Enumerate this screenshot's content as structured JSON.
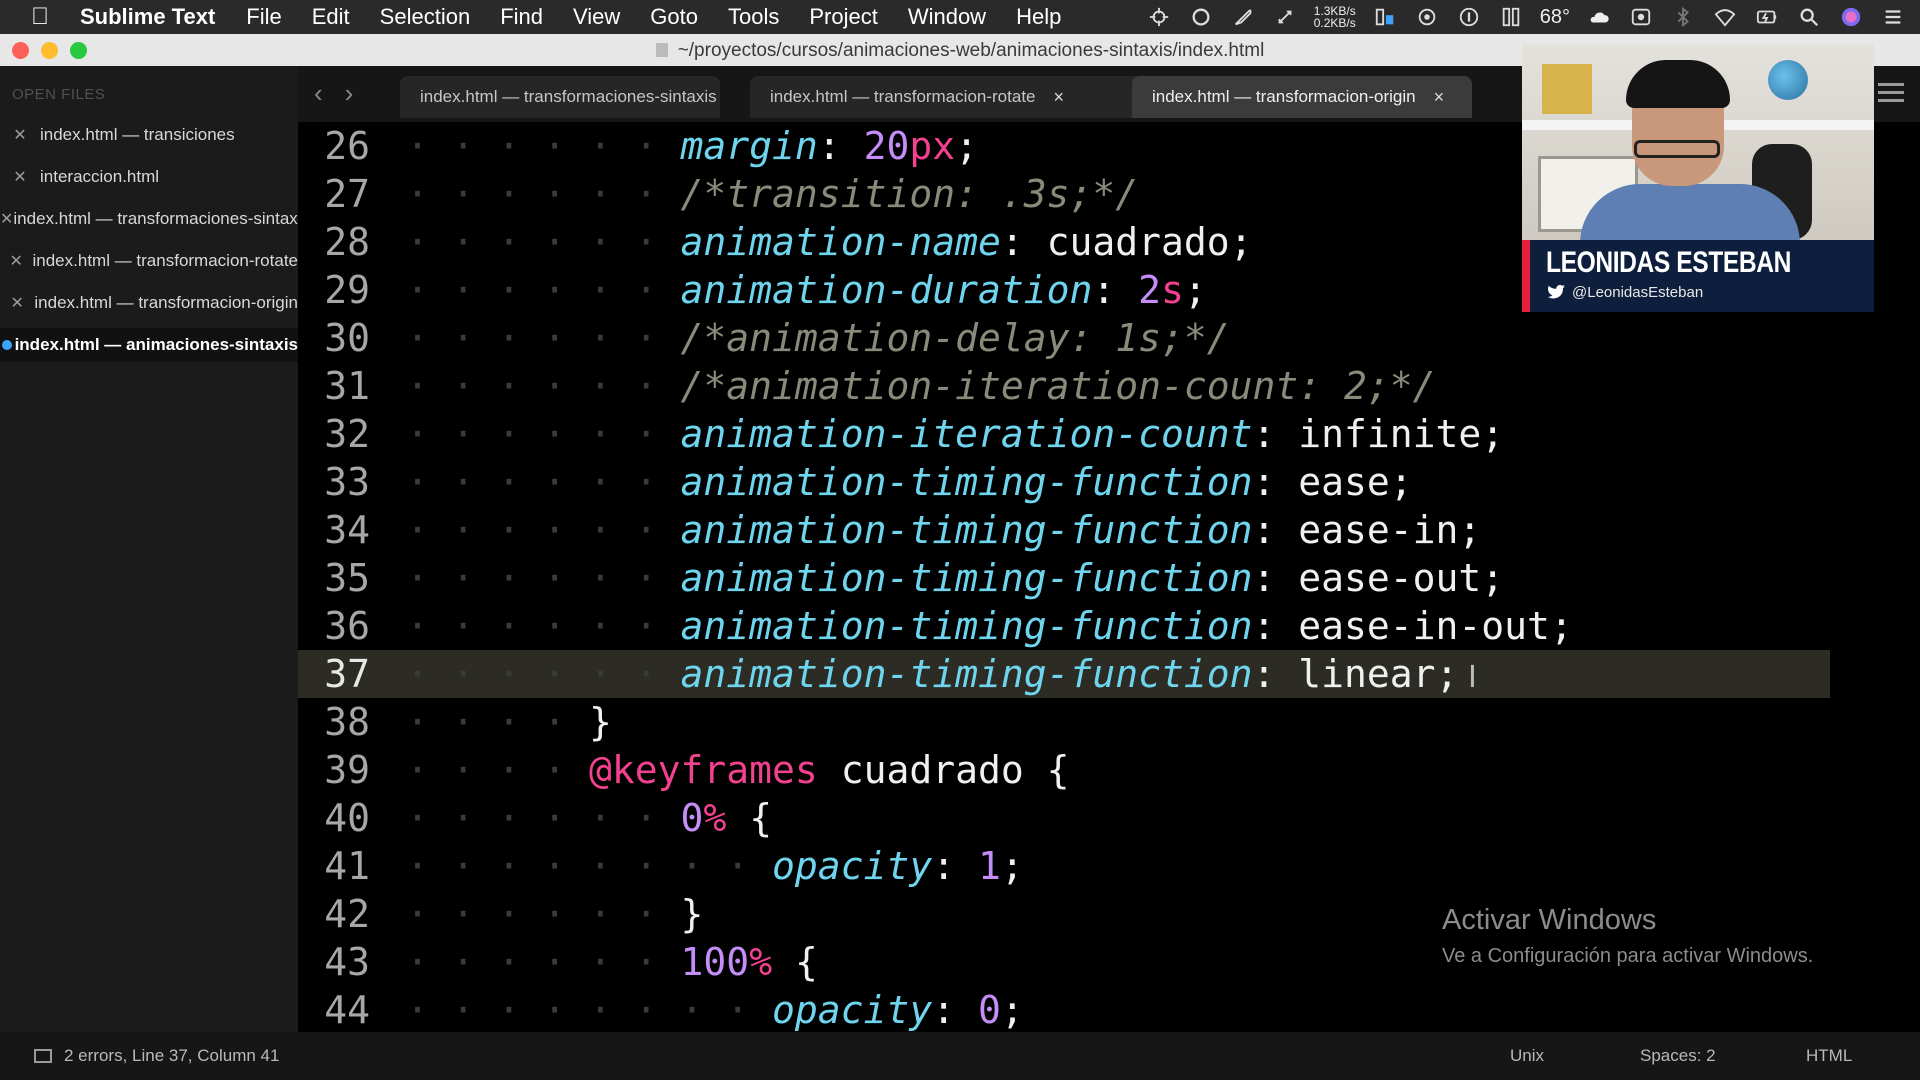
{
  "menubar": {
    "apple_icon": "apple-logo-icon",
    "app_name": "Sublime Text",
    "menus": [
      "File",
      "Edit",
      "Selection",
      "Find",
      "View",
      "Goto",
      "Tools",
      "Project",
      "Window",
      "Help"
    ],
    "net_up": "1.3KB/s",
    "net_down": "0.2KB/s",
    "temperature": "68°"
  },
  "window": {
    "title": "~/proyectos/cursos/animaciones-web/animaciones-sintaxis/index.html"
  },
  "sidebar": {
    "header": "OPEN FILES",
    "items": [
      {
        "label": "index.html — transiciones",
        "active": false
      },
      {
        "label": "interaccion.html",
        "active": false
      },
      {
        "label": "index.html — transformaciones-sintaxis",
        "active": false
      },
      {
        "label": "index.html — transformacion-rotate",
        "active": false
      },
      {
        "label": "index.html — transformacion-origin",
        "active": false
      },
      {
        "label": "index.html — animaciones-sintaxis",
        "active": true
      }
    ]
  },
  "tabs": [
    {
      "label": "index.html — transformaciones-sintaxis",
      "close": ""
    },
    {
      "label": "index.html — transformacion-rotate",
      "close": "×"
    },
    {
      "label": "index.html — transformacion-origin",
      "close": "×"
    }
  ],
  "editor": {
    "current_line": 37,
    "lines": [
      {
        "n": "26",
        "indent": 3
      },
      {
        "n": "27",
        "indent": 3
      },
      {
        "n": "28",
        "indent": 3
      },
      {
        "n": "29",
        "indent": 3
      },
      {
        "n": "30",
        "indent": 3
      },
      {
        "n": "31",
        "indent": 3
      },
      {
        "n": "32",
        "indent": 3
      },
      {
        "n": "33",
        "indent": 3
      },
      {
        "n": "34",
        "indent": 3
      },
      {
        "n": "35",
        "indent": 3
      },
      {
        "n": "36",
        "indent": 3
      },
      {
        "n": "37",
        "indent": 3
      },
      {
        "n": "38",
        "indent": 2
      },
      {
        "n": "39",
        "indent": 2
      },
      {
        "n": "40",
        "indent": 3
      },
      {
        "n": "41",
        "indent": 4
      },
      {
        "n": "42",
        "indent": 3
      },
      {
        "n": "43",
        "indent": 3
      },
      {
        "n": "44",
        "indent": 4
      }
    ],
    "tokens": {
      "l26": [
        [
          "prop",
          "margin"
        ],
        [
          "punc",
          ": "
        ],
        [
          "num",
          "20"
        ],
        [
          "unit",
          "px"
        ],
        [
          "punc",
          ";"
        ]
      ],
      "l27": [
        [
          "cm",
          "/*transition: .3s;*/"
        ]
      ],
      "l28": [
        [
          "prop",
          "animation-name"
        ],
        [
          "punc",
          ": "
        ],
        [
          "val",
          "cuadrado"
        ],
        [
          "punc",
          ";"
        ]
      ],
      "l29": [
        [
          "prop",
          "animation-duration"
        ],
        [
          "punc",
          ": "
        ],
        [
          "num",
          "2"
        ],
        [
          "unit",
          "s"
        ],
        [
          "punc",
          ";"
        ]
      ],
      "l30": [
        [
          "cm",
          "/*animation-delay: 1s;*/"
        ]
      ],
      "l31": [
        [
          "cm",
          "/*animation-iteration-count: 2;*/"
        ]
      ],
      "l32": [
        [
          "prop",
          "animation-iteration-count"
        ],
        [
          "punc",
          ": "
        ],
        [
          "val",
          "infinite"
        ],
        [
          "punc",
          ";"
        ]
      ],
      "l33": [
        [
          "prop",
          "animation-timing-function"
        ],
        [
          "punc",
          ": "
        ],
        [
          "val",
          "ease"
        ],
        [
          "punc",
          ";"
        ]
      ],
      "l34": [
        [
          "prop",
          "animation-timing-function"
        ],
        [
          "punc",
          ": "
        ],
        [
          "val",
          "ease-in"
        ],
        [
          "punc",
          ";"
        ]
      ],
      "l35": [
        [
          "prop",
          "animation-timing-function"
        ],
        [
          "punc",
          ": "
        ],
        [
          "val",
          "ease-out"
        ],
        [
          "punc",
          ";"
        ]
      ],
      "l36": [
        [
          "prop",
          "animation-timing-function"
        ],
        [
          "punc",
          ": "
        ],
        [
          "val",
          "ease-in-out"
        ],
        [
          "punc",
          ";"
        ]
      ],
      "l37": [
        [
          "prop",
          "animation-timing-function"
        ],
        [
          "punc",
          ": "
        ],
        [
          "val",
          "linear"
        ],
        [
          "punc",
          ";"
        ]
      ],
      "l38": [
        [
          "punc",
          "}"
        ]
      ],
      "l39": [
        [
          "at",
          "@keyframes"
        ],
        [
          "val",
          " cuadrado "
        ],
        [
          "punc",
          "{"
        ]
      ],
      "l40": [
        [
          "num",
          "0"
        ],
        [
          "unit",
          "%"
        ],
        [
          "punc",
          " {"
        ]
      ],
      "l41": [
        [
          "prop",
          "opacity"
        ],
        [
          "punc",
          ": "
        ],
        [
          "num",
          "1"
        ],
        [
          "punc",
          ";"
        ]
      ],
      "l42": [
        [
          "punc",
          "}"
        ]
      ],
      "l43": [
        [
          "num",
          "100"
        ],
        [
          "unit",
          "%"
        ],
        [
          "punc",
          " {"
        ]
      ],
      "l44": [
        [
          "prop",
          "opacity"
        ],
        [
          "punc",
          ": "
        ],
        [
          "num",
          "0"
        ],
        [
          "punc",
          ";"
        ]
      ]
    }
  },
  "webcam": {
    "name": "LEONIDAS ESTEBAN",
    "handle": "@LeonidasEsteban",
    "accent": "#e6203b"
  },
  "watermark": {
    "title": "Activar Windows",
    "subtitle": "Ve a Configuración para activar Windows."
  },
  "statusbar": {
    "position": "2 errors, Line 37, Column 41",
    "line_endings": "Unix",
    "indentation": "Spaces: 2",
    "syntax": "HTML"
  }
}
